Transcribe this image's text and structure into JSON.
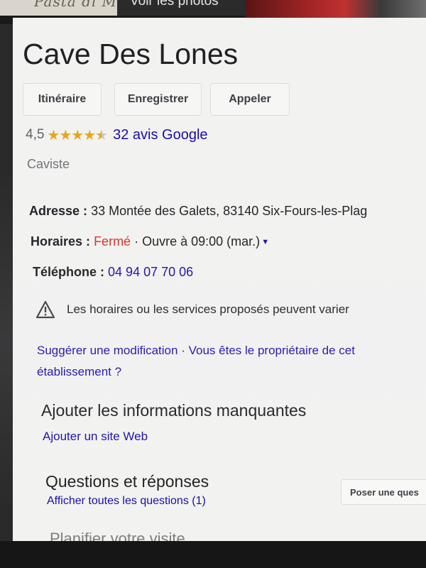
{
  "photos": {
    "left_caption": "Pasta di M",
    "overlay_label": "Voir les photos"
  },
  "place": {
    "name": "Cave Des Lones",
    "category": "Caviste"
  },
  "actions": {
    "directions": "Itinéraire",
    "save": "Enregistrer",
    "call": "Appeler"
  },
  "rating": {
    "value": "4,5",
    "stars_value": 4.5,
    "stars_out_of": 5,
    "reviews": "32 avis Google"
  },
  "details": {
    "address_label": "Adresse :",
    "address": "33 Montée des Galets, 83140 Six-Fours-les-Plag",
    "hours_label": "Horaires :",
    "status": "Fermé",
    "separator": "·",
    "opens": "Ouvre à 09:00 (mar.)",
    "phone_label": "Téléphone :",
    "phone": "04 94 07 70 06"
  },
  "notice": "Les horaires ou les services proposés peuvent varier",
  "suggest": {
    "edit": "Suggérer une modification",
    "separator": "·",
    "owner": "Vous êtes le propriétaire de cet établissement ?"
  },
  "missing": {
    "title": "Ajouter les informations manquantes",
    "add_site": "Ajouter un site Web"
  },
  "qa": {
    "title": "Questions et réponses",
    "all_questions": "Afficher toutes les questions (1)",
    "ask_button": "Poser une ques"
  },
  "next_section_partial": "Planifier votre visite",
  "colors": {
    "link": "#1a0dab",
    "closed": "#d93025",
    "star": "#e6a817"
  }
}
